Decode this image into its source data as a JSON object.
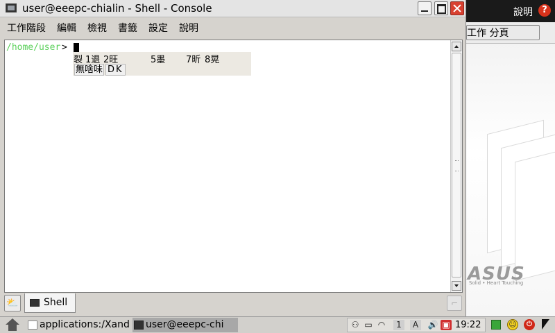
{
  "desktop": {
    "help_label": "說明",
    "help_icon": "?",
    "tab_label": "工作 分頁",
    "logo_text": "ASUS",
    "logo_tagline": "Solid • Heart Touching"
  },
  "window": {
    "title": "user@eeepc-chialin - Shell - Console",
    "menu": [
      "工作階段",
      "編輯",
      "檢視",
      "書籤",
      "設定",
      "說明"
    ]
  },
  "terminal": {
    "prompt_path": "/home/user",
    "prompt_symbol": ">",
    "ime": {
      "candidates": [
        "裂",
        "1退",
        "2旺",
        "5墨",
        "7昕",
        "8晃"
      ],
      "preedit": "無啥味",
      "code": "DK"
    }
  },
  "tabs": {
    "session_tab_label": "Shell",
    "new_session_icon": "sun-window-icon",
    "close_session_icon": "close-session-icon"
  },
  "taskbar": {
    "items": [
      {
        "label": "applications:/Xand",
        "icon": "folder-icon"
      },
      {
        "label": "user@eeepc-chi",
        "icon": "terminal-icon"
      }
    ],
    "tray_icons": [
      "network-icon",
      "battery-icon",
      "wifi-icon",
      "input-method-1-icon",
      "input-method-a-icon",
      "volume-icon",
      "power-icon"
    ],
    "clock": "19:22",
    "tray_symbols": [
      "⚇",
      "▭",
      "◠",
      "1",
      "A",
      "🔊",
      "▣"
    ]
  }
}
